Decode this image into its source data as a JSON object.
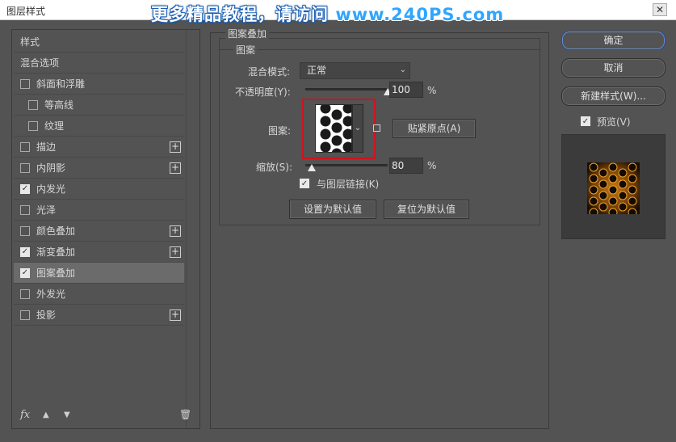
{
  "window": {
    "title": "图层样式",
    "watermark_text": "更多精品教程，请访问 ",
    "watermark_url": "www.240PS.com",
    "close_label": "✕"
  },
  "styles_panel": {
    "items": [
      {
        "label": "样式",
        "checkbox": false,
        "checked": false,
        "plus": false,
        "indent": false,
        "selected": false
      },
      {
        "label": "混合选项",
        "checkbox": false,
        "checked": false,
        "plus": false,
        "indent": false,
        "selected": false
      },
      {
        "label": "斜面和浮雕",
        "checkbox": true,
        "checked": false,
        "plus": false,
        "indent": false,
        "selected": false
      },
      {
        "label": "等高线",
        "checkbox": true,
        "checked": false,
        "plus": false,
        "indent": true,
        "selected": false
      },
      {
        "label": "纹理",
        "checkbox": true,
        "checked": false,
        "plus": false,
        "indent": true,
        "selected": false
      },
      {
        "label": "描边",
        "checkbox": true,
        "checked": false,
        "plus": true,
        "indent": false,
        "selected": false
      },
      {
        "label": "内阴影",
        "checkbox": true,
        "checked": false,
        "plus": true,
        "indent": false,
        "selected": false
      },
      {
        "label": "内发光",
        "checkbox": true,
        "checked": true,
        "plus": false,
        "indent": false,
        "selected": false
      },
      {
        "label": "光泽",
        "checkbox": true,
        "checked": false,
        "plus": false,
        "indent": false,
        "selected": false
      },
      {
        "label": "颜色叠加",
        "checkbox": true,
        "checked": false,
        "plus": true,
        "indent": false,
        "selected": false
      },
      {
        "label": "渐变叠加",
        "checkbox": true,
        "checked": true,
        "plus": true,
        "indent": false,
        "selected": false
      },
      {
        "label": "图案叠加",
        "checkbox": true,
        "checked": true,
        "plus": false,
        "indent": false,
        "selected": true
      },
      {
        "label": "外发光",
        "checkbox": true,
        "checked": false,
        "plus": false,
        "indent": false,
        "selected": false
      },
      {
        "label": "投影",
        "checkbox": true,
        "checked": false,
        "plus": true,
        "indent": false,
        "selected": false
      }
    ],
    "footer": {
      "fx_label": "fx",
      "up_icon": "▲",
      "down_icon": "▼",
      "trash_icon": "🗑"
    }
  },
  "pattern_overlay": {
    "group_title": "图案叠加",
    "subgroup_title": "图案",
    "blend_mode_label": "混合模式:",
    "blend_mode_value": "正常",
    "opacity_label": "不透明度(Y):",
    "opacity_value": "100",
    "opacity_unit": "%",
    "opacity_level": 1.0,
    "pattern_label": "图案:",
    "snap_button": "贴紧原点(A)",
    "scale_label": "缩放(S):",
    "scale_value": "80",
    "scale_unit": "%",
    "scale_level": 0.08,
    "link_label": "与图层链接(K)",
    "link_checked": true,
    "set_default_button": "设置为默认值",
    "reset_default_button": "复位为默认值"
  },
  "actions": {
    "ok": "确定",
    "cancel": "取消",
    "new_style": "新建样式(W)...",
    "preview_label": "预览(V)",
    "preview_checked": true
  },
  "colors": {
    "panel_bg": "#535353",
    "highlight_box": "#d0121f",
    "preview_bg": "#3b3b3b"
  }
}
